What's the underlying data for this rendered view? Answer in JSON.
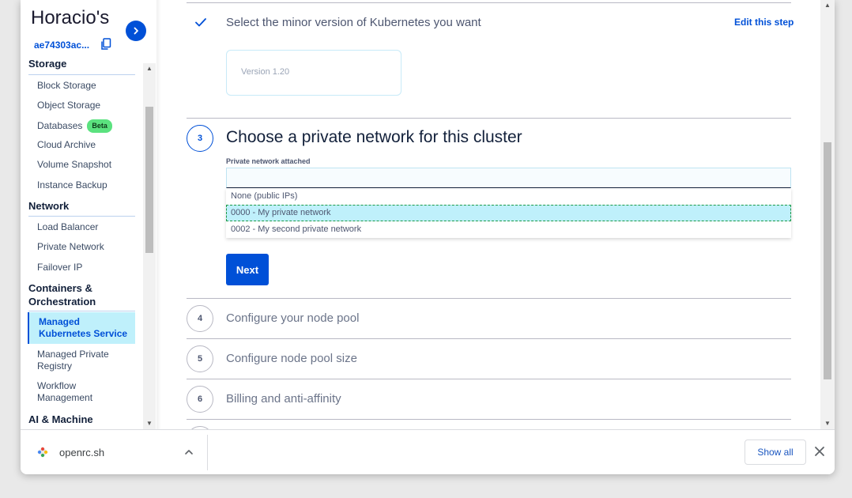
{
  "sidebar": {
    "project_name": "Horacio's",
    "project_id": "ae74303ac...",
    "partial_section_top": "Storage",
    "storage_items": [
      "Block Storage",
      "Object Storage",
      "Databases",
      "Cloud Archive",
      "Volume Snapshot",
      "Instance Backup"
    ],
    "databases_badge": "Beta",
    "network_section": "Network",
    "network_items": [
      "Load Balancer",
      "Private Network",
      "Failover IP"
    ],
    "containers_section_line1": "Containers &",
    "containers_section_line2": "Orchestration",
    "containers_items": [
      {
        "line1": "Managed",
        "line2": "Kubernetes Service"
      },
      {
        "line1": "Managed Private",
        "line2": "Registry"
      },
      {
        "line1": "Workflow",
        "line2": "Management"
      }
    ],
    "ai_section": "AI & Machine"
  },
  "step2": {
    "title": "Select the minor version of Kubernetes you want",
    "edit_link": "Edit this step",
    "version_tile": "Version 1.20"
  },
  "step3": {
    "number": "3",
    "title": "Choose a private network for this cluster",
    "field_label": "Private network attached",
    "input_value": "",
    "options": [
      "None (public IPs)",
      "0000 - My private network",
      "0002 - My second private network"
    ],
    "highlighted_option": 1,
    "next_label": "Next"
  },
  "upcoming_steps": [
    {
      "number": "4",
      "title": "Configure your node pool"
    },
    {
      "number": "5",
      "title": "Configure node pool size"
    },
    {
      "number": "6",
      "title": "Billing and anti-affinity"
    }
  ],
  "download_bar": {
    "filename": "openrc.sh",
    "show_all": "Show all"
  },
  "colors": {
    "primary": "#0050d7",
    "highlight_bg": "#bff0fb",
    "beta_badge": "#5be27f"
  }
}
